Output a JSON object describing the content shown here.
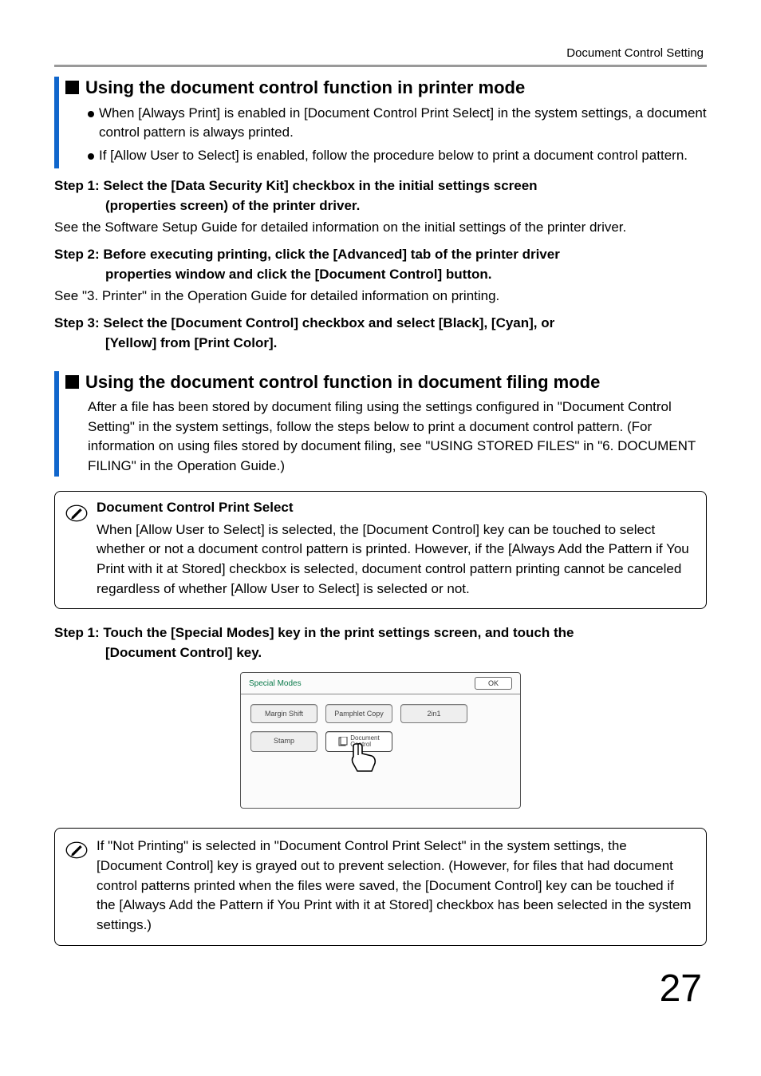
{
  "header": {
    "section_label": "Document Control Setting"
  },
  "sec1": {
    "title": "Using the document control function in printer mode",
    "bullets": [
      "When [Always Print] is enabled in [Document Control Print Select] in the system settings, a document control pattern is always printed.",
      "If [Allow User to Select] is enabled, follow the procedure below to print a document control pattern."
    ],
    "step1_h": "Step 1: Select the [Data Security Kit] checkbox in the initial settings screen (properties screen) of the printer driver.",
    "step1_p": "See the Software Setup Guide for detailed information on the initial settings of the printer driver.",
    "step2_h": "Step 2: Before executing printing, click the [Advanced] tab of the printer driver properties window and click the [Document Control] button.",
    "step2_p": "See \"3. Printer\" in the Operation Guide for detailed information on printing.",
    "step3_h": "Step 3: Select the [Document Control] checkbox and select [Black], [Cyan], or [Yellow] from [Print Color]."
  },
  "sec2": {
    "title": "Using the document control function in document filing mode",
    "intro": "After a file has been stored by document filing using the settings configured in \"Document Control Setting\" in the system settings, follow the steps below to print a document control pattern. (For information on using files stored by document filing, see \"USING STORED FILES\" in \"6. DOCUMENT FILING\" in the Operation Guide.)",
    "note_title": "Document Control Print Select",
    "note_text": "When [Allow User to Select] is selected, the [Document Control] key can be touched to select whether or not a document control pattern is printed. However, if the [Always Add the Pattern if You Print with it at Stored] checkbox is selected, document control pattern printing cannot be canceled regardless of whether [Allow User to Select] is selected or not.",
    "step1_h": "Step 1: Touch the [Special Modes] key in the print settings screen, and touch the [Document Control] key.",
    "panel": {
      "title": "Special Modes",
      "ok": "OK",
      "btns": {
        "margin": "Margin Shift",
        "pamphlet": "Pamphlet Copy",
        "twoin1": "2in1",
        "stamp": "Stamp",
        "document": "Document Control"
      }
    },
    "note2_text": "If \"Not Printing\" is selected in \"Document Control Print Select\" in the system settings, the [Document Control] key is grayed out to prevent selection. (However, for files that had document control patterns printed when the files were saved, the [Document Control] key can be touched if the [Always Add the Pattern if You Print with it at Stored] checkbox has been selected in the system settings.)"
  },
  "page_number": "27"
}
